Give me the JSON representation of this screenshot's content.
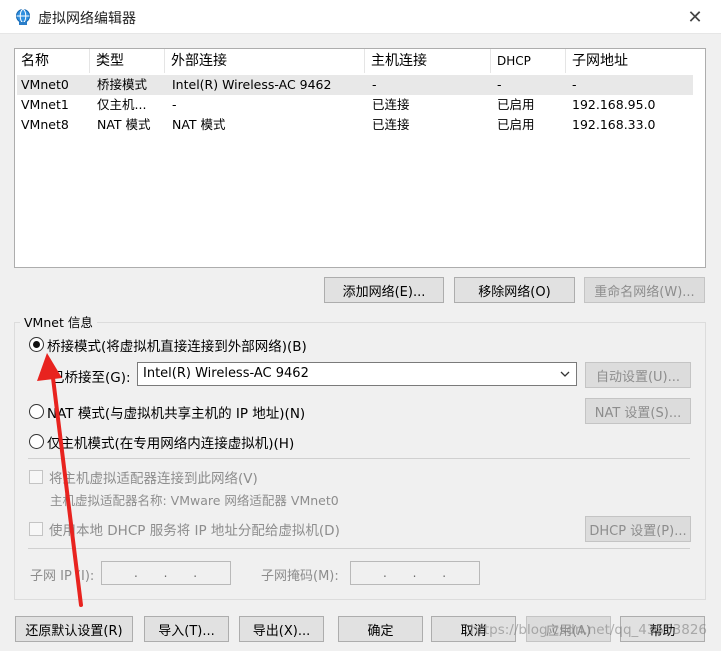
{
  "window": {
    "title": "虚拟网络编辑器",
    "close_label": "✕"
  },
  "network_table": {
    "columns": [
      "名称",
      "类型",
      "外部连接",
      "主机连接",
      "DHCP",
      "子网地址"
    ],
    "rows": [
      [
        "VMnet0",
        "桥接模式",
        "Intel(R) Wireless-AC 9462",
        "-",
        "-",
        "-"
      ],
      [
        "VMnet1",
        "仅主机...",
        "-",
        "已连接",
        "已启用",
        "192.168.95.0"
      ],
      [
        "VMnet8",
        "NAT 模式",
        "NAT 模式",
        "已连接",
        "已启用",
        "192.168.33.0"
      ]
    ],
    "selected_row": 0
  },
  "list_buttons": {
    "add": "添加网络(E)...",
    "remove": "移除网络(O)",
    "rename": "重命名网络(W)..."
  },
  "vmnet_info": {
    "group_label": "VMnet 信息",
    "bridge_mode": "桥接模式(将虚拟机直接连接到外部网络)(B)",
    "bridged_to_label": "已桥接至(G):",
    "bridged_to_value": "Intel(R) Wireless-AC 9462",
    "auto_settings": "自动设置(U)...",
    "nat_mode": "NAT 模式(与虚拟机共享主机的 IP 地址)(N)",
    "nat_settings": "NAT 设置(S)...",
    "host_only": "仅主机模式(在专用网络内连接虚拟机)(H)",
    "connect_adapter": "将主机虚拟适配器连接到此网络(V)",
    "adapter_name": "主机虚拟适配器名称: VMware 网络适配器 VMnet0",
    "use_dhcp": "使用本地 DHCP 服务将 IP 地址分配给虚拟机(D)",
    "dhcp_settings": "DHCP 设置(P)...",
    "subnet_ip_label": "子网 IP (I):",
    "subnet_mask_label": "子网掩码(M):",
    "ip_dots": ". . .",
    "mask_dots": ". . ."
  },
  "bottom_buttons": {
    "restore": "还原默认设置(R)",
    "import": "导入(T)...",
    "export": "导出(X)...",
    "ok": "确定",
    "cancel": "取消",
    "apply": "应用(A)",
    "help": "帮助"
  },
  "watermark": "https://blog.csdn.net/qq_43553826",
  "colors": {
    "annotation_arrow": "#e8231f"
  },
  "icons": {
    "title": "network-globe-icon",
    "close": "close-icon",
    "dropdown": "chevron-down-icon"
  }
}
